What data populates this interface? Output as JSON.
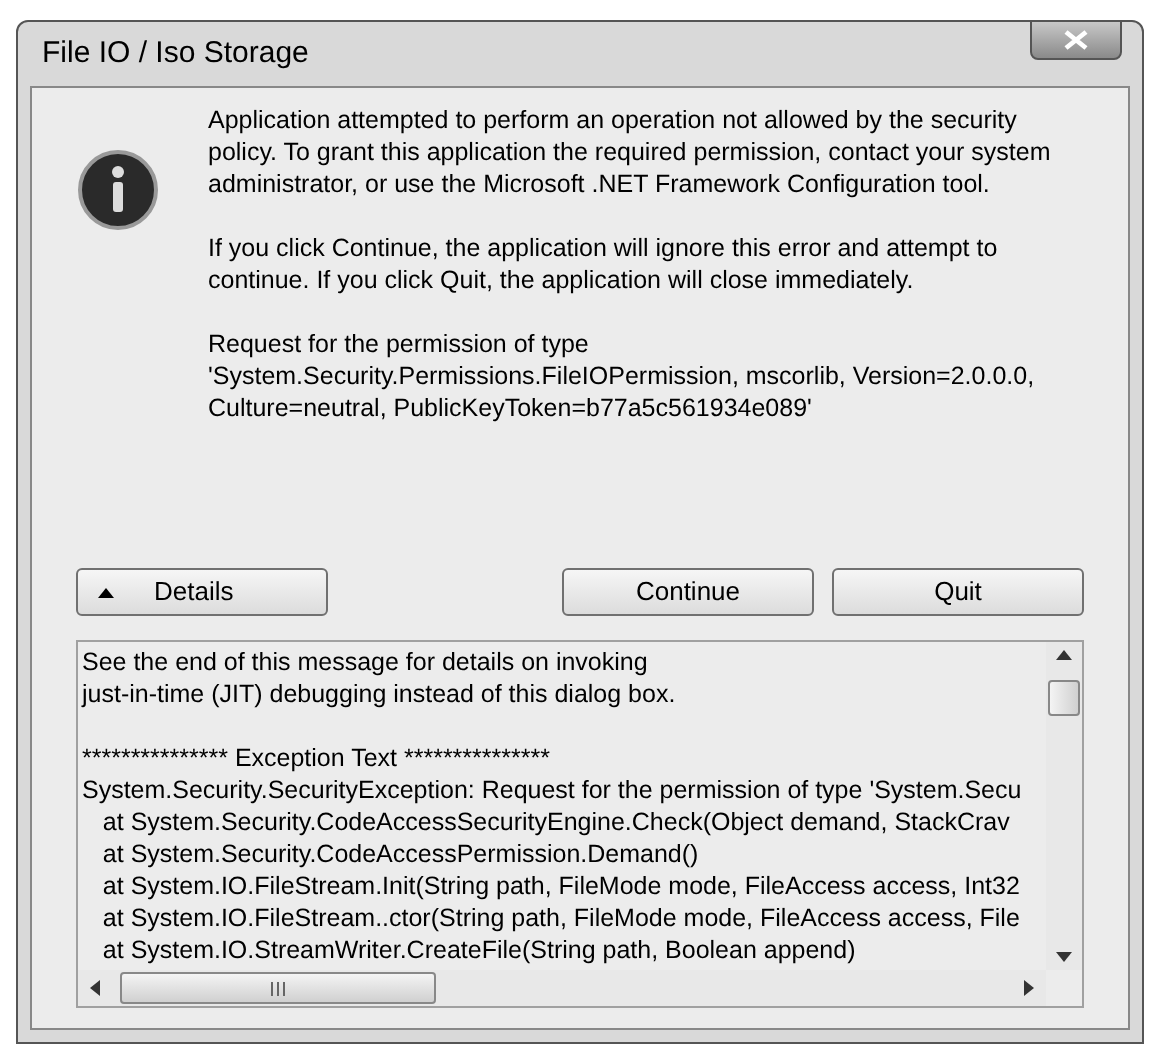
{
  "window": {
    "title": "File IO / Iso Storage"
  },
  "message": {
    "paragraphs": [
      "Application attempted to perform an operation not allowed by the security policy. To grant this application the required permission, contact your system administrator, or use the Microsoft .NET Framework Configuration tool.",
      "If you click Continue, the application will ignore this error and attempt to continue. If you click Quit, the application will close immediately.",
      "Request for the permission of type 'System.Security.Permissions.FileIOPermission, mscorlib, Version=2.0.0.0, Culture=neutral, PublicKeyToken=b77a5c561934e089'"
    ]
  },
  "details_button": {
    "label": "Details",
    "expanded": true
  },
  "buttons": [
    "Continue",
    "Quit"
  ],
  "details_text": {
    "blocks": [
      [
        "See the end of this message for details on invoking",
        "just-in-time (JIT) debugging instead of this dialog box."
      ],
      [
        "*************** Exception Text ***************",
        "System.Security.SecurityException: Request for the permission of type 'System.Secu",
        "   at System.Security.CodeAccessSecurityEngine.Check(Object demand, StackCrav",
        "   at System.Security.CodeAccessPermission.Demand()",
        "   at System.IO.FileStream.Init(String path, FileMode mode, FileAccess access, Int32",
        "   at System.IO.FileStream..ctor(String path, FileMode mode, FileAccess access, File",
        "   at System.IO.StreamWriter.CreateFile(String path, Boolean append)"
      ]
    ]
  }
}
